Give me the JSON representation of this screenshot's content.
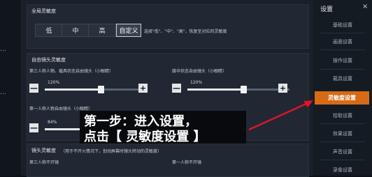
{
  "left_strip": {
    "ticks": [
      "…",
      "…"
    ]
  },
  "global": {
    "title": "全局灵敏度",
    "segments": [
      {
        "label": "低",
        "active": false
      },
      {
        "label": "中",
        "active": false
      },
      {
        "label": "高",
        "active": false
      },
      {
        "label": "自定义",
        "active": true
      }
    ],
    "hint": "选择\"低\"、\"中\"、\"高\"，恢复至对应的灵敏度"
  },
  "free_camera": {
    "title": "自由镜头灵敏度",
    "third_label": "第三人称人物、载具状态自由镜头（小眼睛）",
    "third_value": "120%",
    "third_level": 0.55,
    "para_label": "跳伞状态自由镜头（小眼睛）",
    "para_value": "120%",
    "para_level": 0.55,
    "first_label": "第一人称人物自由镜头（小眼睛）",
    "first_value": "84%",
    "first_level": 0.38
  },
  "camera": {
    "title": "镜头灵敏度",
    "hint": "（用于不开火情况下，划动屏幕时镜头转动的灵敏度）",
    "third_label": "第三人称不开镜",
    "first_label": "第一人称不开镜"
  },
  "controls": {
    "minus": "—",
    "plus": "+"
  },
  "sidebar": {
    "title": "设置",
    "close": "×",
    "items": [
      {
        "label": "基础设置",
        "active": false
      },
      {
        "label": "画面设置",
        "active": false
      },
      {
        "label": "操作设置",
        "active": false
      },
      {
        "label": "载具设置",
        "active": false
      },
      {
        "label": "灵敏度设置",
        "active": true
      },
      {
        "label": "拾取设置",
        "active": false
      },
      {
        "label": "效果设置",
        "active": false
      },
      {
        "label": "声音设置",
        "active": false
      },
      {
        "label": "录像设置",
        "active": false
      }
    ]
  },
  "callout": {
    "line1": "第一步：进入设置，",
    "line2": "点击【 灵敏度设置 】"
  },
  "colors": {
    "accent": "#d86a16",
    "arrow": "#e0132a",
    "panel": "#212833"
  }
}
